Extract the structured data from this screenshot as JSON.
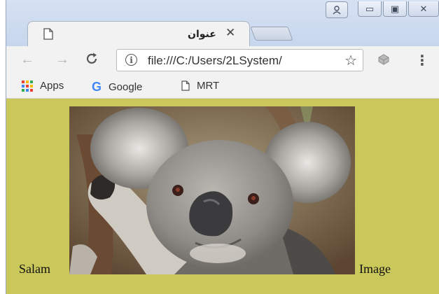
{
  "browser": {
    "tab": {
      "title": "عنوان",
      "close_glyph": "✕"
    },
    "toolbar": {
      "back_glyph": "←",
      "forward_glyph": "→",
      "reload_glyph": "C",
      "address": "file:///C:/Users/2LSystem/",
      "info_glyph": "i",
      "star_glyph": "☆",
      "menu_glyph": "⋮"
    },
    "window_controls": {
      "minimize": "▭",
      "maximize": "▣",
      "close": "✕"
    },
    "bookmarks": [
      {
        "label": "Apps",
        "icon": "apps-grid-icon"
      },
      {
        "label": "Google",
        "icon": "google-icon"
      },
      {
        "label": "MRT",
        "icon": "page-icon"
      }
    ]
  },
  "page": {
    "background_color": "#cac85a",
    "left_text": "Salam",
    "right_text": "Image",
    "image": {
      "subject": "koala",
      "icon": "koala-photo"
    }
  }
}
